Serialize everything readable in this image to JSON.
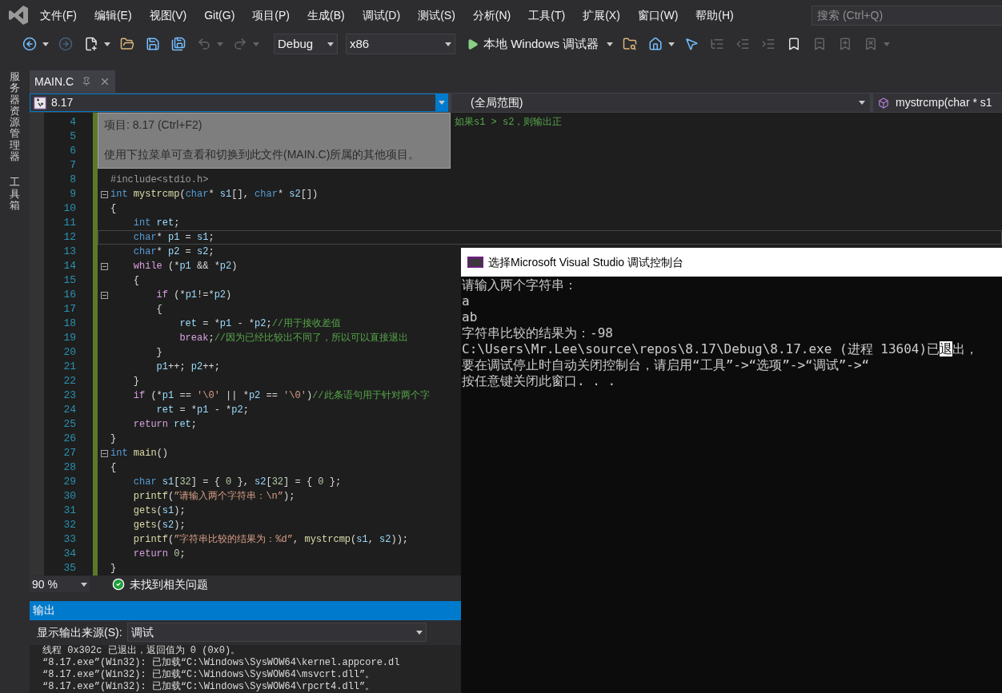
{
  "menu": {
    "items": [
      "文件(F)",
      "编辑(E)",
      "视图(V)",
      "Git(G)",
      "项目(P)",
      "生成(B)",
      "调试(D)",
      "测试(S)",
      "分析(N)",
      "工具(T)",
      "扩展(X)",
      "窗口(W)",
      "帮助(H)"
    ],
    "search_placeholder": "搜索 (Ctrl+Q)"
  },
  "toolbar": {
    "left_buttons": [
      {
        "kind": "back",
        "disabled": false,
        "dropdown": true
      },
      {
        "kind": "forward",
        "disabled": true,
        "dropdown": false
      },
      {
        "kind": "new",
        "disabled": false,
        "dropdown": true
      },
      {
        "kind": "open",
        "disabled": false,
        "dropdown": false
      },
      {
        "kind": "save",
        "disabled": false,
        "dropdown": false
      },
      {
        "kind": "save_all",
        "disabled": false,
        "dropdown": false
      },
      {
        "kind": "undo",
        "disabled": true,
        "dropdown": true
      },
      {
        "kind": "redo",
        "disabled": true,
        "dropdown": true
      }
    ],
    "configuration": "Debug",
    "platform": "x86",
    "run_label": "本地 Windows 调试器",
    "right_buttons": [
      {
        "kind": "find",
        "disabled": false,
        "dropdown": false
      },
      {
        "kind": "home",
        "disabled": false,
        "dropdown": true
      },
      {
        "kind": "pointer",
        "disabled": false,
        "dropdown": false
      },
      {
        "kind": "list",
        "disabled": true,
        "dropdown": false
      },
      {
        "kind": "outdent",
        "disabled": true,
        "dropdown": false
      },
      {
        "kind": "indent",
        "disabled": true,
        "dropdown": false
      },
      {
        "kind": "bookmark",
        "disabled": false,
        "dropdown": false
      },
      {
        "kind": "prev_bookmark",
        "disabled": true,
        "dropdown": false
      },
      {
        "kind": "next_bookmark",
        "disabled": true,
        "dropdown": false
      },
      {
        "kind": "clear_bookmark",
        "disabled": true,
        "dropdown": true
      }
    ]
  },
  "side_tabs": [
    "服务器资源管理器",
    "工具箱"
  ],
  "editor": {
    "tabs": [
      {
        "label": "MAIN.C",
        "selected": true
      }
    ],
    "nav": {
      "project": "8.17",
      "scope": "(全局范围)",
      "member": "mystrcmp(char * s1"
    },
    "tooltip": {
      "title": "项目: 8.17 (Ctrl+F2)",
      "text": "使用下拉菜单可查看和切换到此文件(MAIN.C)所属的其他项目。"
    },
    "lines": [
      {
        "number": "4",
        "fold": false,
        "current": false,
        "covered": true,
        "tokens": [
          {
            "kind": "comment",
            "text": "如果s1 > s2，则输出正"
          }
        ]
      },
      {
        "number": "5",
        "fold": false,
        "current": false
      },
      {
        "number": "6",
        "fold": false,
        "current": false
      },
      {
        "number": "7",
        "fold": false,
        "current": false
      },
      {
        "number": "8",
        "fold": false,
        "current": false,
        "tokens": [
          {
            "kind": "pre",
            "text": "#include<stdio.h>"
          }
        ]
      },
      {
        "number": "9",
        "fold": true,
        "current": false,
        "tokens": [
          {
            "kind": "type",
            "text": "int "
          },
          {
            "kind": "func",
            "text": "mystrcmp"
          },
          {
            "kind": "plain",
            "text": "("
          },
          {
            "kind": "type",
            "text": "char"
          },
          {
            "kind": "plain",
            "text": "* "
          },
          {
            "kind": "var",
            "text": "s1"
          },
          {
            "kind": "plain",
            "text": "[], "
          },
          {
            "kind": "type",
            "text": "char"
          },
          {
            "kind": "plain",
            "text": "* "
          },
          {
            "kind": "var",
            "text": "s2"
          },
          {
            "kind": "plain",
            "text": "[])"
          }
        ]
      },
      {
        "number": "10",
        "fold": false,
        "current": false,
        "tokens": [
          {
            "kind": "plain",
            "text": "{"
          }
        ]
      },
      {
        "number": "11",
        "fold": false,
        "current": false,
        "tokens": [
          {
            "kind": "type",
            "text": "    int"
          },
          {
            "kind": "var",
            "text": " ret"
          },
          {
            "kind": "plain",
            "text": ";"
          }
        ]
      },
      {
        "number": "12",
        "fold": false,
        "current": true,
        "tokens": [
          {
            "kind": "type",
            "text": "    char"
          },
          {
            "kind": "plain",
            "text": "* "
          },
          {
            "kind": "var",
            "text": "p1"
          },
          {
            "kind": "plain",
            "text": " = "
          },
          {
            "kind": "var",
            "text": "s1"
          },
          {
            "kind": "plain",
            "text": ";"
          }
        ]
      },
      {
        "number": "13",
        "fold": false,
        "current": false,
        "tokens": [
          {
            "kind": "type",
            "text": "    char"
          },
          {
            "kind": "plain",
            "text": "* "
          },
          {
            "kind": "var",
            "text": "p2"
          },
          {
            "kind": "plain",
            "text": " = "
          },
          {
            "kind": "var",
            "text": "s2"
          },
          {
            "kind": "plain",
            "text": ";"
          }
        ]
      },
      {
        "number": "14",
        "fold": true,
        "current": false,
        "tokens": [
          {
            "kind": "control",
            "text": "    while"
          },
          {
            "kind": "plain",
            "text": " (*"
          },
          {
            "kind": "var",
            "text": "p1"
          },
          {
            "kind": "plain",
            "text": " && *"
          },
          {
            "kind": "var",
            "text": "p2"
          },
          {
            "kind": "plain",
            "text": ")"
          }
        ]
      },
      {
        "number": "15",
        "fold": false,
        "current": false,
        "tokens": [
          {
            "kind": "plain",
            "text": "    {"
          }
        ]
      },
      {
        "number": "16",
        "fold": true,
        "current": false,
        "tokens": [
          {
            "kind": "control",
            "text": "        if"
          },
          {
            "kind": "plain",
            "text": " (*"
          },
          {
            "kind": "var",
            "text": "p1"
          },
          {
            "kind": "plain",
            "text": "!=*"
          },
          {
            "kind": "var",
            "text": "p2"
          },
          {
            "kind": "plain",
            "text": ")"
          }
        ]
      },
      {
        "number": "17",
        "fold": false,
        "current": false,
        "tokens": [
          {
            "kind": "plain",
            "text": "        {"
          }
        ]
      },
      {
        "number": "18",
        "fold": false,
        "current": false,
        "tokens": [
          {
            "kind": "var",
            "text": "            ret"
          },
          {
            "kind": "plain",
            "text": " = *"
          },
          {
            "kind": "var",
            "text": "p1"
          },
          {
            "kind": "plain",
            "text": " - *"
          },
          {
            "kind": "var",
            "text": "p2"
          },
          {
            "kind": "plain",
            "text": ";"
          },
          {
            "kind": "comment",
            "text": "//用于接收差值"
          }
        ]
      },
      {
        "number": "19",
        "fold": false,
        "current": false,
        "tokens": [
          {
            "kind": "control",
            "text": "            break"
          },
          {
            "kind": "plain",
            "text": ";"
          },
          {
            "kind": "comment",
            "text": "//因为已经比较出不同了，所以可以直接退出"
          }
        ]
      },
      {
        "number": "20",
        "fold": false,
        "current": false,
        "tokens": [
          {
            "kind": "plain",
            "text": "        }"
          }
        ]
      },
      {
        "number": "21",
        "fold": false,
        "current": false,
        "tokens": [
          {
            "kind": "var",
            "text": "        p1"
          },
          {
            "kind": "plain",
            "text": "++; "
          },
          {
            "kind": "var",
            "text": "p2"
          },
          {
            "kind": "plain",
            "text": "++;"
          }
        ]
      },
      {
        "number": "22",
        "fold": false,
        "current": false,
        "tokens": [
          {
            "kind": "plain",
            "text": "    }"
          }
        ]
      },
      {
        "number": "23",
        "fold": false,
        "current": false,
        "tokens": [
          {
            "kind": "control",
            "text": "    if"
          },
          {
            "kind": "plain",
            "text": " (*"
          },
          {
            "kind": "var",
            "text": "p1"
          },
          {
            "kind": "plain",
            "text": " == "
          },
          {
            "kind": "string",
            "text": "'\\0'"
          },
          {
            "kind": "plain",
            "text": " || *"
          },
          {
            "kind": "var",
            "text": "p2"
          },
          {
            "kind": "plain",
            "text": " == "
          },
          {
            "kind": "string",
            "text": "'\\0'"
          },
          {
            "kind": "plain",
            "text": ")"
          },
          {
            "kind": "comment",
            "text": "//此条语句用于针对两个字"
          }
        ]
      },
      {
        "number": "24",
        "fold": false,
        "current": false,
        "tokens": [
          {
            "kind": "var",
            "text": "        ret"
          },
          {
            "kind": "plain",
            "text": " = *"
          },
          {
            "kind": "var",
            "text": "p1"
          },
          {
            "kind": "plain",
            "text": " - *"
          },
          {
            "kind": "var",
            "text": "p2"
          },
          {
            "kind": "plain",
            "text": ";"
          }
        ]
      },
      {
        "number": "25",
        "fold": false,
        "current": false,
        "tokens": [
          {
            "kind": "control",
            "text": "    return"
          },
          {
            "kind": "var",
            "text": " ret"
          },
          {
            "kind": "plain",
            "text": ";"
          }
        ]
      },
      {
        "number": "26",
        "fold": false,
        "current": false,
        "tokens": [
          {
            "kind": "plain",
            "text": "}"
          }
        ]
      },
      {
        "number": "27",
        "fold": true,
        "current": false,
        "tokens": [
          {
            "kind": "type",
            "text": "int "
          },
          {
            "kind": "func",
            "text": "main"
          },
          {
            "kind": "plain",
            "text": "()"
          }
        ]
      },
      {
        "number": "28",
        "fold": false,
        "current": false,
        "tokens": [
          {
            "kind": "plain",
            "text": "{"
          }
        ]
      },
      {
        "number": "29",
        "fold": false,
        "current": false,
        "tokens": [
          {
            "kind": "type",
            "text": "    char"
          },
          {
            "kind": "var",
            "text": " s1"
          },
          {
            "kind": "plain",
            "text": "["
          },
          {
            "kind": "number",
            "text": "32"
          },
          {
            "kind": "plain",
            "text": "] = { "
          },
          {
            "kind": "number",
            "text": "0"
          },
          {
            "kind": "plain",
            "text": " }, "
          },
          {
            "kind": "var",
            "text": "s2"
          },
          {
            "kind": "plain",
            "text": "["
          },
          {
            "kind": "number",
            "text": "32"
          },
          {
            "kind": "plain",
            "text": "] = { "
          },
          {
            "kind": "number",
            "text": "0"
          },
          {
            "kind": "plain",
            "text": " };"
          }
        ]
      },
      {
        "number": "30",
        "fold": false,
        "current": false,
        "tokens": [
          {
            "kind": "func",
            "text": "    printf"
          },
          {
            "kind": "plain",
            "text": "("
          },
          {
            "kind": "string",
            "text": "”请输入两个字符串：\\n”"
          },
          {
            "kind": "plain",
            "text": ");"
          }
        ]
      },
      {
        "number": "31",
        "fold": false,
        "current": false,
        "tokens": [
          {
            "kind": "func",
            "text": "    gets"
          },
          {
            "kind": "plain",
            "text": "("
          },
          {
            "kind": "var",
            "text": "s1"
          },
          {
            "kind": "plain",
            "text": ");"
          }
        ]
      },
      {
        "number": "32",
        "fold": false,
        "current": false,
        "tokens": [
          {
            "kind": "func",
            "text": "    gets"
          },
          {
            "kind": "plain",
            "text": "("
          },
          {
            "kind": "var",
            "text": "s2"
          },
          {
            "kind": "plain",
            "text": ");"
          }
        ]
      },
      {
        "number": "33",
        "fold": false,
        "current": false,
        "tokens": [
          {
            "kind": "func",
            "text": "    printf"
          },
          {
            "kind": "plain",
            "text": "("
          },
          {
            "kind": "string",
            "text": "”字符串比较的结果为：%d”"
          },
          {
            "kind": "plain",
            "text": ", "
          },
          {
            "kind": "func",
            "text": "mystrcmp"
          },
          {
            "kind": "plain",
            "text": "("
          },
          {
            "kind": "var",
            "text": "s1"
          },
          {
            "kind": "plain",
            "text": ", "
          },
          {
            "kind": "var",
            "text": "s2"
          },
          {
            "kind": "plain",
            "text": "));"
          }
        ]
      },
      {
        "number": "34",
        "fold": false,
        "current": false,
        "tokens": [
          {
            "kind": "control",
            "text": "    return "
          },
          {
            "kind": "number",
            "text": "0"
          },
          {
            "kind": "plain",
            "text": ";"
          }
        ]
      },
      {
        "number": "35",
        "fold": false,
        "current": false,
        "tokens": [
          {
            "kind": "plain",
            "text": "}"
          }
        ]
      }
    ],
    "zoom": "90 %",
    "issues": "未找到相关问题"
  },
  "output": {
    "title": "输出",
    "source_label": "显示输出来源(S):",
    "source": "调试",
    "lines": [
      "线程 0x302c 已退出，返回值为 0 (0x0)。",
      "“8.17.exe”(Win32): 已加载“C:\\Windows\\SysWOW64\\kernel.appcore.dl",
      "“8.17.exe”(Win32): 已加载“C:\\Windows\\SysWOW64\\msvcrt.dll”。",
      "“8.17.exe”(Win32): 已加载“C:\\Windows\\SysWOW64\\rpcrt4.dll”。"
    ]
  },
  "console": {
    "title": "选择Microsoft Visual Studio 调试控制台",
    "lines": [
      {
        "parts": [
          {
            "text": "请输入两个字符串：",
            "selected": false
          }
        ]
      },
      {
        "parts": [
          {
            "text": "a",
            "selected": false
          }
        ]
      },
      {
        "parts": [
          {
            "text": "ab",
            "selected": false
          }
        ]
      },
      {
        "parts": [
          {
            "text": "字符串比较的结果为：-98",
            "selected": false
          }
        ]
      },
      {
        "parts": [
          {
            "text": "C:\\Users\\Mr.Lee\\source\\repos\\8.17\\Debug\\8.17.exe (进程 13604)已",
            "selected": false
          },
          {
            "text": "退",
            "selected": true
          },
          {
            "text": "出，",
            "selected": false
          }
        ]
      },
      {
        "parts": [
          {
            "text": "要在调试停止时自动关闭控制台，请启用“工具”->“选项”->“调试”->“",
            "selected": false
          }
        ]
      },
      {
        "parts": [
          {
            "text": "按任意键关闭此窗口. . .",
            "selected": false
          }
        ]
      }
    ]
  }
}
